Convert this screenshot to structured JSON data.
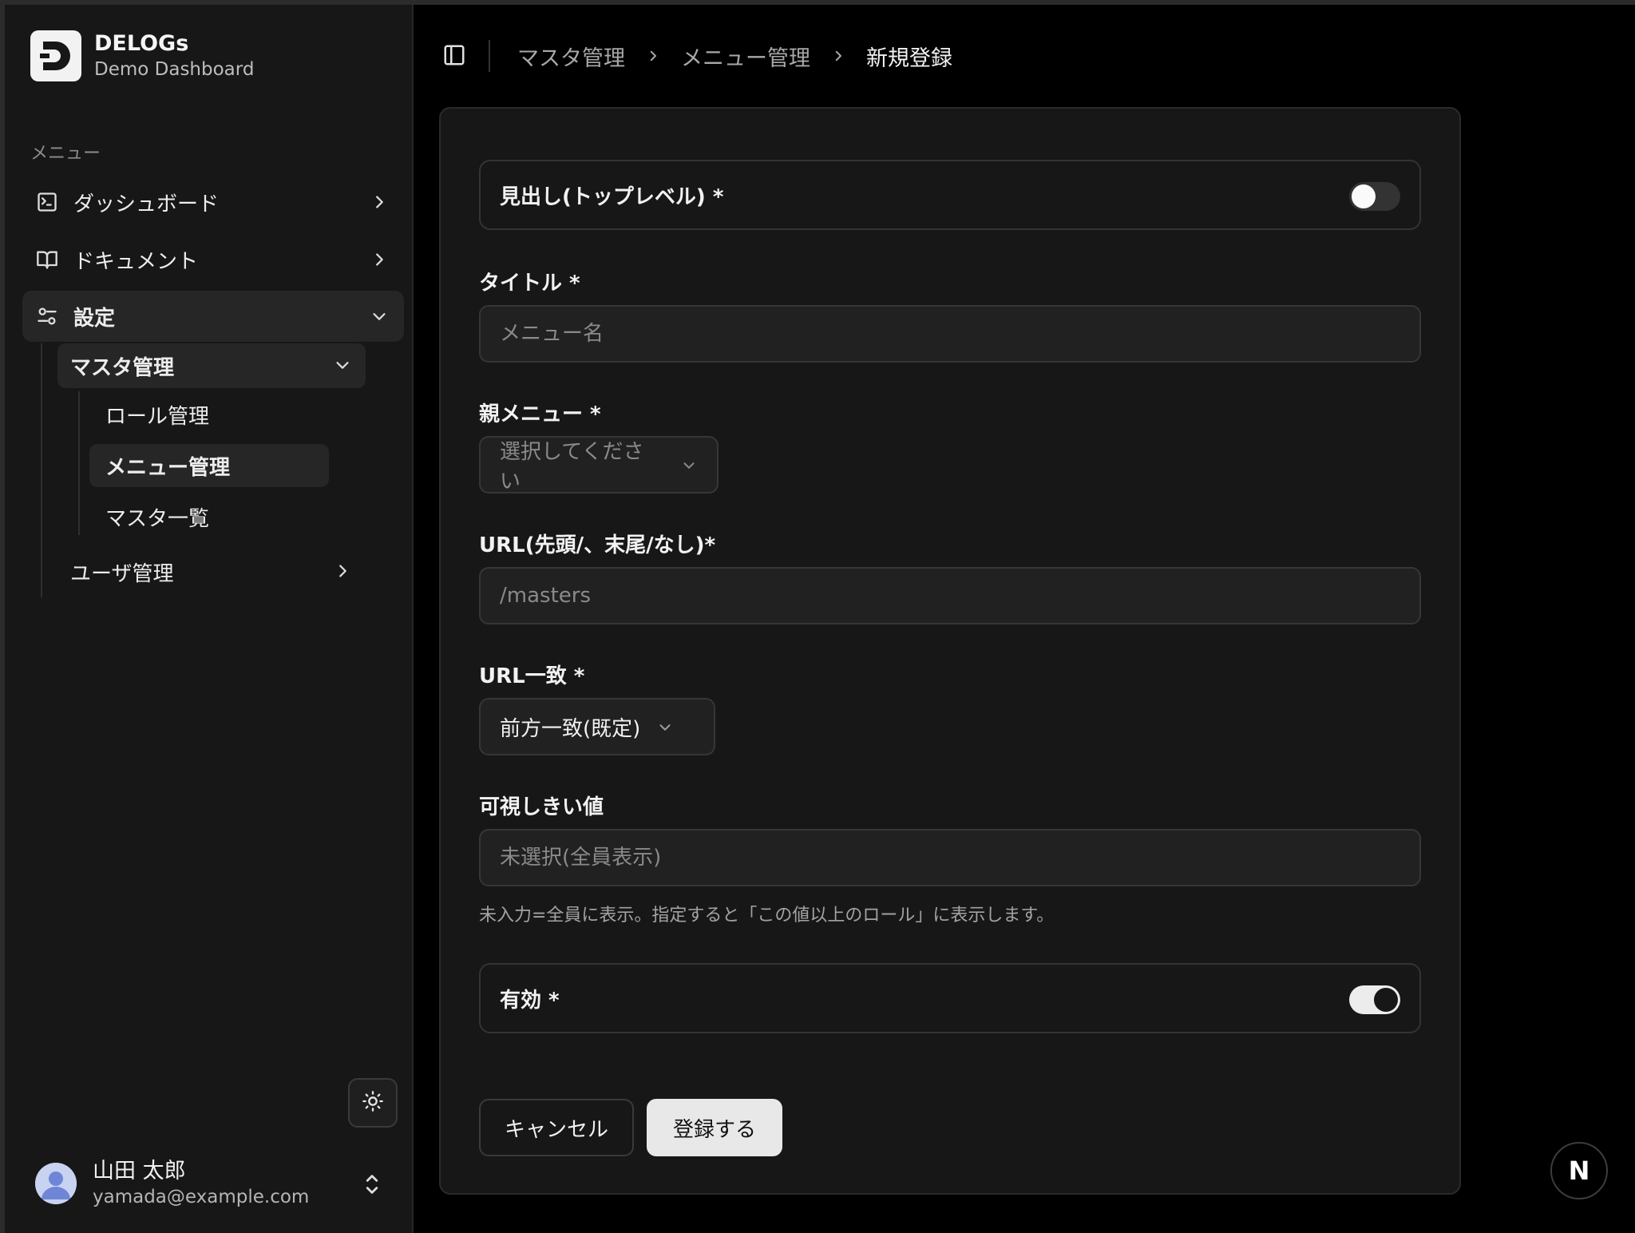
{
  "brand": {
    "name": "DELOGs",
    "subtitle": "Demo Dashboard",
    "logo_letter": "D"
  },
  "sidebar": {
    "section_label": "メニュー",
    "items": [
      {
        "label": "ダッシュボード",
        "icon": "terminal-square-icon"
      },
      {
        "label": "ドキュメント",
        "icon": "book-open-icon"
      },
      {
        "label": "設定",
        "icon": "settings-sliders-icon",
        "expanded": true
      }
    ],
    "submenu": {
      "master": "マスタ管理",
      "children": [
        "ロール管理",
        "メニュー管理",
        "マスタ一覧"
      ],
      "active_child": "メニュー管理",
      "user_management": "ユーザ管理"
    }
  },
  "user": {
    "name": "山田 太郎",
    "email": "yamada@example.com"
  },
  "breadcrumb": {
    "items": [
      "マスタ管理",
      "メニュー管理"
    ],
    "current": "新規登録"
  },
  "form": {
    "heading_toggle": {
      "label": "見出し(トップレベル) *",
      "on": false
    },
    "title": {
      "label": "タイトル *",
      "placeholder": "メニュー名",
      "value": ""
    },
    "parent": {
      "label": "親メニュー *",
      "selected": "選択してください"
    },
    "url": {
      "label": "URL(先頭/、末尾/なし)*",
      "placeholder": "/masters",
      "value": ""
    },
    "url_match": {
      "label": "URL一致 *",
      "selected": "前方一致(既定)"
    },
    "threshold": {
      "label": "可視しきい値",
      "placeholder": "未選択(全員表示)",
      "helper": "未入力=全員に表示。指定すると「この値以上のロール」に表示します。"
    },
    "enabled_toggle": {
      "label": "有効 *",
      "on": true
    },
    "cancel_label": "キャンセル",
    "submit_label": "登録する"
  },
  "badge": {
    "letter": "N"
  },
  "colors": {
    "background": "#000000",
    "sidebar": "#171717",
    "card": "#171717",
    "accent": "#e8e8e8"
  }
}
